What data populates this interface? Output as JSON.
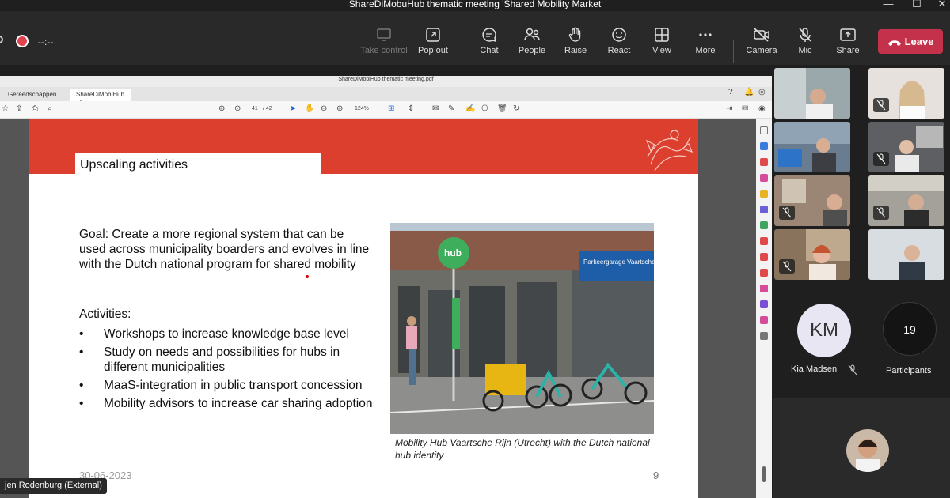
{
  "window": {
    "title": "ShareDiMobuHub thematic meeting 'Shared Mobility Market"
  },
  "toolbar": {
    "recording_time": "--:--",
    "take_control": "Take control",
    "pop_out": "Pop out",
    "chat": "Chat",
    "people": "People",
    "raise": "Raise",
    "react": "React",
    "view": "View",
    "more": "More",
    "camera": "Camera",
    "mic": "Mic",
    "share": "Share",
    "leave": "Leave"
  },
  "pdf": {
    "filename": "ShareDiMobiHub thematic meeting.pdf",
    "tabs": [
      "Gereedschappen",
      "ShareDiMobiHub..."
    ],
    "page_current": "41",
    "page_total": "/ 42",
    "zoom": "124%"
  },
  "slide": {
    "title": "Upscaling activities",
    "goal": "Goal: Create a more regional system that can be used across municipality boarders and evolves in line with the Dutch national program for shared mobility",
    "activities_heading": "Activities:",
    "activities": [
      "Workshops to increase knowledge base level",
      "Study on needs and possibilities for hubs in different municipalities",
      "MaaS-integration in public transport concession",
      "Mobility advisors to increase car sharing adoption"
    ],
    "photo_hub_sign": "hub",
    "photo_parking_sign": "Parkeergarage Vaartsche Rijn",
    "caption": "Mobility Hub Vaartsche Rijn (Utrecht) with the Dutch national hub identity",
    "date": "30-06-2023",
    "page_number": "9"
  },
  "presenter": {
    "name": "jen Rodenburg (External)"
  },
  "participants": {
    "avatar_initials": "KM",
    "avatar_name": "Kia Madsen",
    "count": "19",
    "count_label": "Participants"
  },
  "colors": {
    "slide_band": "#dc3f2e",
    "leave": "#c4314b",
    "avatar_bg": "#e8e6f2"
  }
}
